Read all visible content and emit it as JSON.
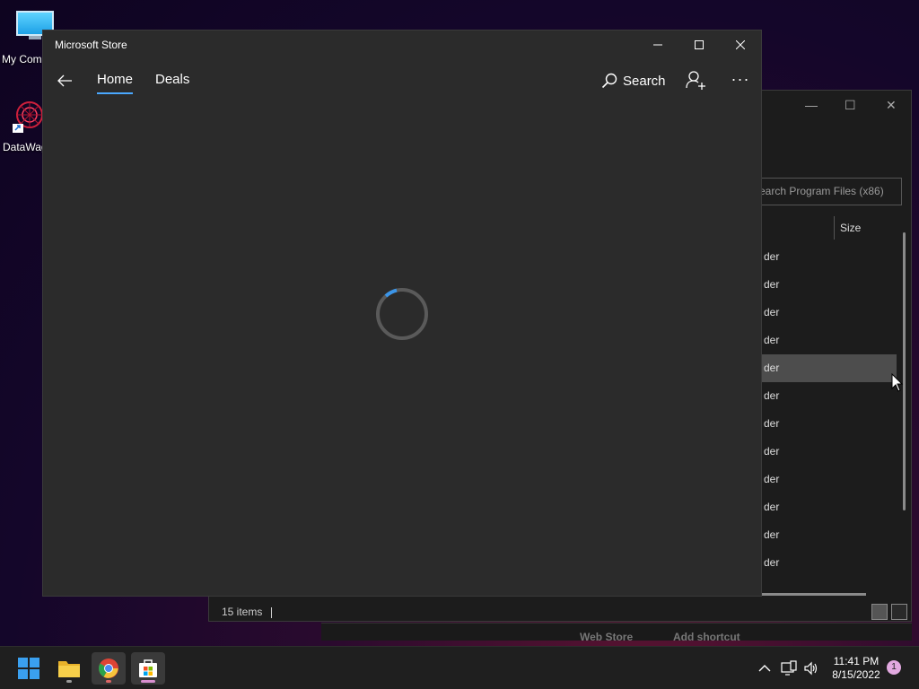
{
  "desktop": {
    "icons": [
      {
        "label": "My Com",
        "icon": "computer-icon"
      },
      {
        "label": "DataWag",
        "icon": "datawag-app-icon"
      }
    ]
  },
  "explorer": {
    "search_placeholder": "earch Program Files (x86)",
    "columns": {
      "size": "Size"
    },
    "rows": [
      "der",
      "der",
      "der",
      "der",
      "der",
      "der",
      "der",
      "der",
      "der",
      "der",
      "der",
      "der"
    ],
    "selected_row_index": 4,
    "status": "15 items"
  },
  "under_window": {
    "web_store": "Web Store",
    "add_shortcut": "Add shortcut"
  },
  "store": {
    "title": "Microsoft Store",
    "nav": {
      "home": "Home",
      "deals": "Deals",
      "search": "Search"
    },
    "accent_color": "#4aa8ff",
    "loading": true
  },
  "taskbar": {
    "apps": [
      "start-icon",
      "file-explorer-icon",
      "chrome-icon",
      "microsoft-store-icon"
    ],
    "time": "11:41 PM",
    "date": "8/15/2022",
    "notification_count": "1"
  }
}
